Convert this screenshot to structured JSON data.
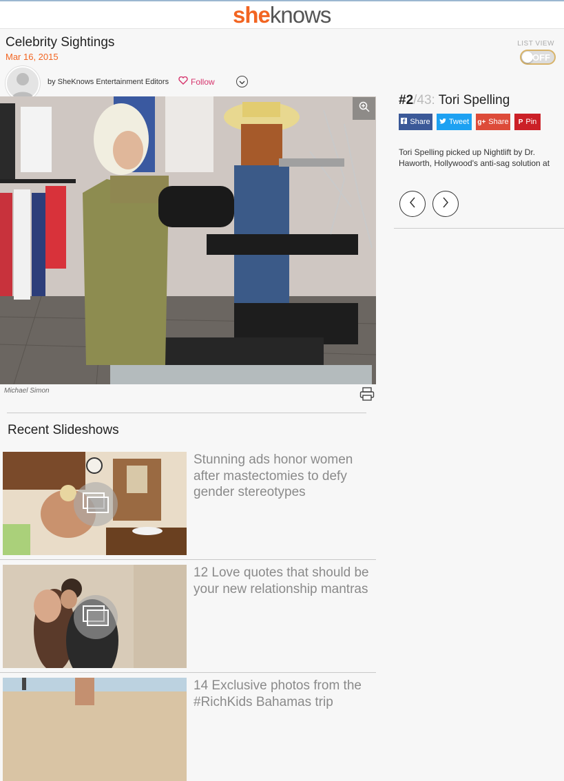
{
  "header": {
    "logo_she": "she",
    "logo_knows": "knows"
  },
  "gallery": {
    "title": "Celebrity Sightings",
    "date": "Mar 16, 2015",
    "author": "by SheKnows Entertainment Editors",
    "follow_label": "Follow",
    "list_view_label": "LIST VIEW",
    "list_view_state": "OFF",
    "photo_credit": "Michael Simon"
  },
  "slide": {
    "number": "#2",
    "total": "/43:",
    "name": " Tori Spelling",
    "description": "Tori Spelling picked up Nightlift by Dr. Haworth, Hollywood's anti-sag solution at"
  },
  "share_buttons": [
    {
      "label": "Share",
      "icon": "facebook-icon",
      "color": "#3b5998"
    },
    {
      "label": "Tweet",
      "icon": "twitter-icon",
      "color": "#1da1f2"
    },
    {
      "label": "Share",
      "icon": "google-plus-icon",
      "color": "#dd4b39"
    },
    {
      "label": "Pin",
      "icon": "pinterest-icon",
      "color": "#cb2027"
    }
  ],
  "recent": {
    "heading": "Recent Slideshows",
    "items": [
      {
        "title": "Stunning ads honor women after mastectomies to defy gender stereotypes"
      },
      {
        "title": "12 Love quotes that should be your new relationship mantras"
      },
      {
        "title": "14 Exclusive photos from the #RichKids Bahamas trip"
      }
    ]
  },
  "colors": {
    "accent": "#f26522",
    "follow": "#d6336c"
  }
}
